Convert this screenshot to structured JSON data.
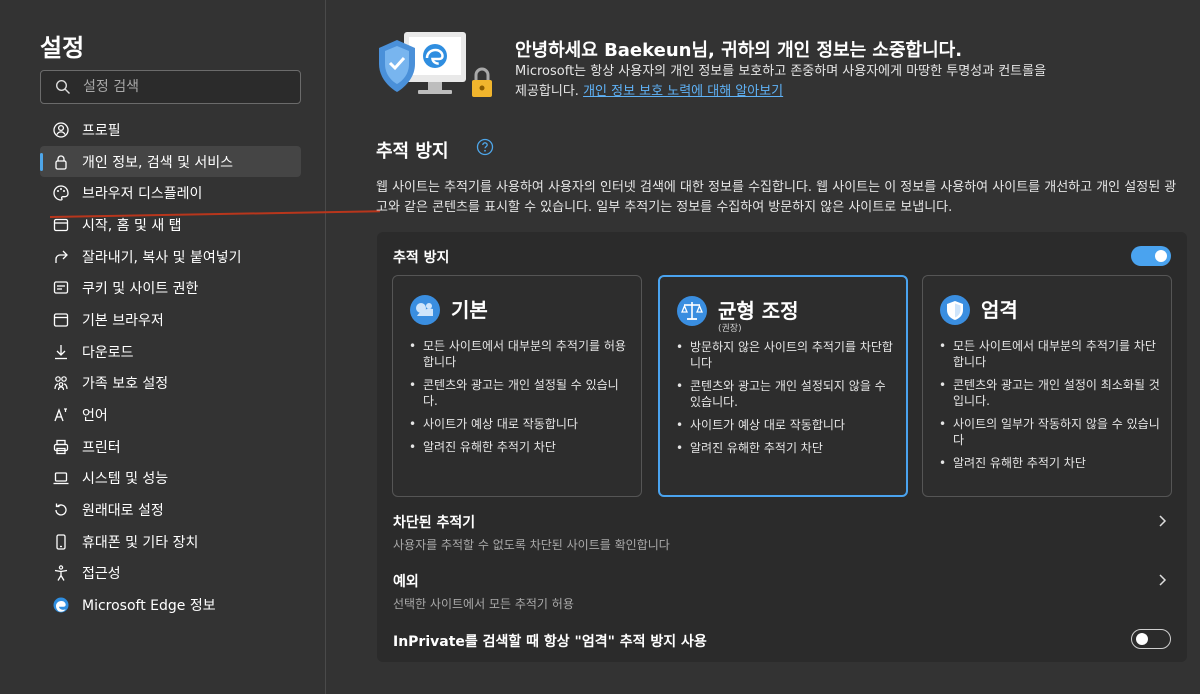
{
  "sidebar": {
    "title": "설정",
    "search_placeholder": "설정 검색",
    "items": [
      {
        "label": "프로필",
        "icon": "profile-icon"
      },
      {
        "label": "개인 정보, 검색 및 서비스",
        "icon": "lock-icon",
        "active": true
      },
      {
        "label": "브라우저 디스플레이",
        "icon": "palette-icon"
      },
      {
        "label": "시작, 홈 및 새 탭",
        "icon": "home-tab-icon"
      },
      {
        "label": "잘라내기, 복사 및 붙여넣기",
        "icon": "share-icon"
      },
      {
        "label": "쿠키 및 사이트 권한",
        "icon": "cookie-icon"
      },
      {
        "label": "기본 브라우저",
        "icon": "browser-icon"
      },
      {
        "label": "다운로드",
        "icon": "download-icon"
      },
      {
        "label": "가족 보호 설정",
        "icon": "family-icon"
      },
      {
        "label": "언어",
        "icon": "language-icon"
      },
      {
        "label": "프린터",
        "icon": "printer-icon"
      },
      {
        "label": "시스템 및 성능",
        "icon": "laptop-icon"
      },
      {
        "label": "원래대로 설정",
        "icon": "reset-icon"
      },
      {
        "label": "휴대폰 및 기타 장치",
        "icon": "phone-icon"
      },
      {
        "label": "접근성",
        "icon": "accessibility-icon"
      },
      {
        "label": "Microsoft Edge 정보",
        "icon": "edge-logo-icon"
      }
    ]
  },
  "hero": {
    "title": "안녕하세요 Baekeun님, 귀하의 개인 정보는 소중합니다.",
    "desc": "Microsoft는 항상 사용자의 개인 정보를 보호하고 존중하며 사용자에게 마땅한 투명성과 컨트롤을 제공합니다.",
    "link": "개인 정보 보호 노력에 대해 알아보기"
  },
  "tracking": {
    "title": "추적 방지",
    "desc": "웹 사이트는 추적기를 사용하여 사용자의 인터넷 검색에 대한 정보를 수집합니다. 웹 사이트는 이 정보를 사용하여 사이트를 개선하고 개인 설정된 광고와 같은 콘텐츠를 표시할 수 있습니다. 일부 추적기는 정보를 수집하여 방문하지 않은 사이트로 보냅니다.",
    "toggle_label": "추적 방지",
    "toggle_on": true,
    "cards": [
      {
        "title": "기본",
        "subtitle": "",
        "bullets": [
          "모든 사이트에서 대부분의 추적기를 허용합니다",
          "콘텐츠와 광고는 개인 설정될 수 있습니다.",
          "사이트가 예상 대로 작동합니다",
          "알려진 유해한 추적기 차단"
        ]
      },
      {
        "title": "균형 조정",
        "subtitle": "(권장)",
        "selected": true,
        "bullets": [
          "방문하지 않은 사이트의 추적기를 차단합니다",
          "콘텐츠와 광고는 개인 설정되지 않을 수 있습니다.",
          "사이트가 예상 대로 작동합니다",
          "알려진 유해한 추적기 차단"
        ]
      },
      {
        "title": "엄격",
        "subtitle": "",
        "bullets": [
          "모든 사이트에서 대부분의 추적기를 차단합니다",
          "콘텐츠와 광고는 개인 설정이 최소화될 것입니다.",
          "사이트의 일부가 작동하지 않을 수 있습니다",
          "알려진 유해한 추적기 차단"
        ]
      }
    ],
    "blocked_title": "차단된 추적기",
    "blocked_desc": "사용자를 추적할 수 없도록 차단된 사이트를 확인합니다",
    "exceptions_title": "예외",
    "exceptions_desc": "선택한 사이트에서 모든 추적기 허용",
    "inprivate_label": "InPrivate를 검색할 때 항상 \"엄격\" 추적 방지 사용",
    "inprivate_on": false
  },
  "colors": {
    "accent": "#4aa3ef",
    "background": "#333333",
    "panel": "#2b2b2b",
    "annotation": "#b8361c"
  }
}
